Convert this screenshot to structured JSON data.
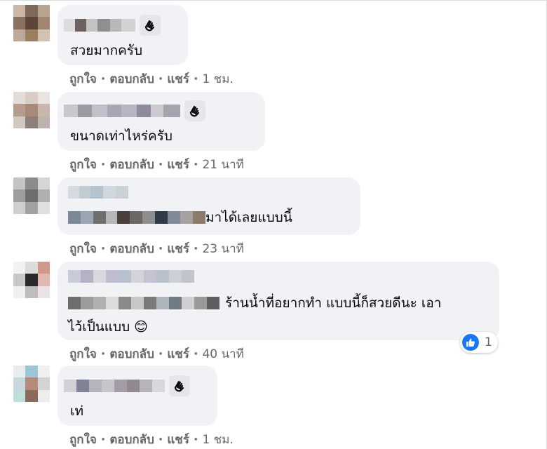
{
  "comments": [
    {
      "text": "สวยมากครับ",
      "actions": {
        "like": "ถูกใจ",
        "reply": "ตอบกลับ",
        "share": "แชร์",
        "time": "1 ชม."
      }
    },
    {
      "text": "ขนาดเท่าไหร่ครับ",
      "actions": {
        "like": "ถูกใจ",
        "reply": "ตอบกลับ",
        "share": "แชร์",
        "time": "21 นาที"
      }
    },
    {
      "text": "มาได้เลยแบบนี้",
      "actions": {
        "like": "ถูกใจ",
        "reply": "ตอบกลับ",
        "share": "แชร์",
        "time": "23 นาที"
      }
    },
    {
      "text_line1": "ร้านน้ำที่อยากทำ แบบนี้ก็สวยดีนะ เอา",
      "text_line2": "ไว้เป็นแบบ",
      "emoji": "😊",
      "reaction": {
        "icon": "like-icon",
        "count": "1"
      },
      "actions": {
        "like": "ถูกใจ",
        "reply": "ตอบกลับ",
        "share": "แชร์",
        "time": "40 นาที"
      }
    },
    {
      "text": "เท่",
      "actions": {
        "like": "ถูกใจ",
        "reply": "ตอบกลับ",
        "share": "แชร์",
        "time": "1 ชม."
      }
    }
  ],
  "colors": {
    "bubble": "#f0f2f5",
    "meta_text": "#65676b",
    "like_blue": "#1877f2"
  },
  "icons": {
    "wave": "wave-hand-icon",
    "like": "like-icon"
  }
}
